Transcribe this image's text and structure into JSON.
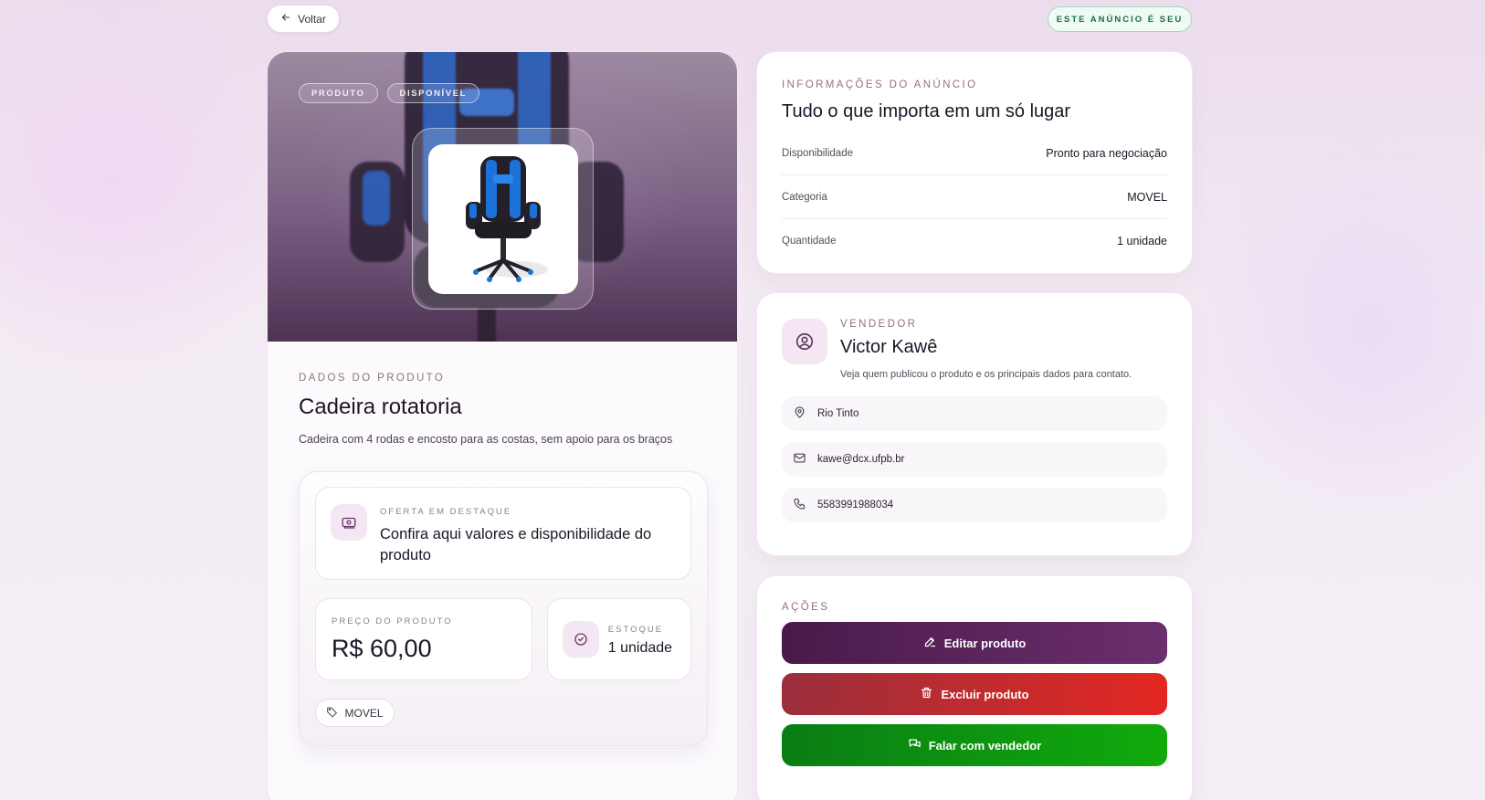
{
  "topbar": {
    "back_label": "Voltar",
    "owner_badge": "ESTE ANÚNCIO É SEU"
  },
  "hero": {
    "tags": [
      "PRODUTO",
      "DISPONÍVEL"
    ]
  },
  "product": {
    "eyebrow": "DADOS DO PRODUTO",
    "title": "Cadeira rotatoria",
    "description": "Cadeira com 4 rodas e encosto para as costas, sem apoio para os braços",
    "highlight_eyebrow": "OFERTA EM DESTAQUE",
    "highlight_text": "Confira aqui valores e disponibilidade do produto",
    "price_label": "PREÇO DO PRODUTO",
    "price_value": "R$ 60,00",
    "stock_label": "ESTOQUE",
    "stock_value": "1 unidade",
    "category_chip": "MOVEL"
  },
  "info": {
    "eyebrow": "INFORMAÇÕES DO ANÚNCIO",
    "title": "Tudo o que importa em um só lugar",
    "rows": [
      {
        "label": "Disponibilidade",
        "value": "Pronto para negociação"
      },
      {
        "label": "Categoria",
        "value": "MOVEL"
      },
      {
        "label": "Quantidade",
        "value": "1 unidade"
      }
    ]
  },
  "seller": {
    "eyebrow": "VENDEDOR",
    "name": "Victor Kawê",
    "description": "Veja quem publicou o produto e os principais dados para contato.",
    "location": "Rio Tinto",
    "email": "kawe@dcx.ufpb.br",
    "phone": "5583991988034"
  },
  "actions": {
    "eyebrow": "AÇÕES",
    "edit_label": "Editar produto",
    "delete_label": "Excluir produto",
    "chat_label": "Falar com vendedor"
  },
  "colors": {
    "edit": "#5a2460",
    "delete": "#c62c2f",
    "chat": "#0e9410",
    "accent_text": "#94707f"
  }
}
